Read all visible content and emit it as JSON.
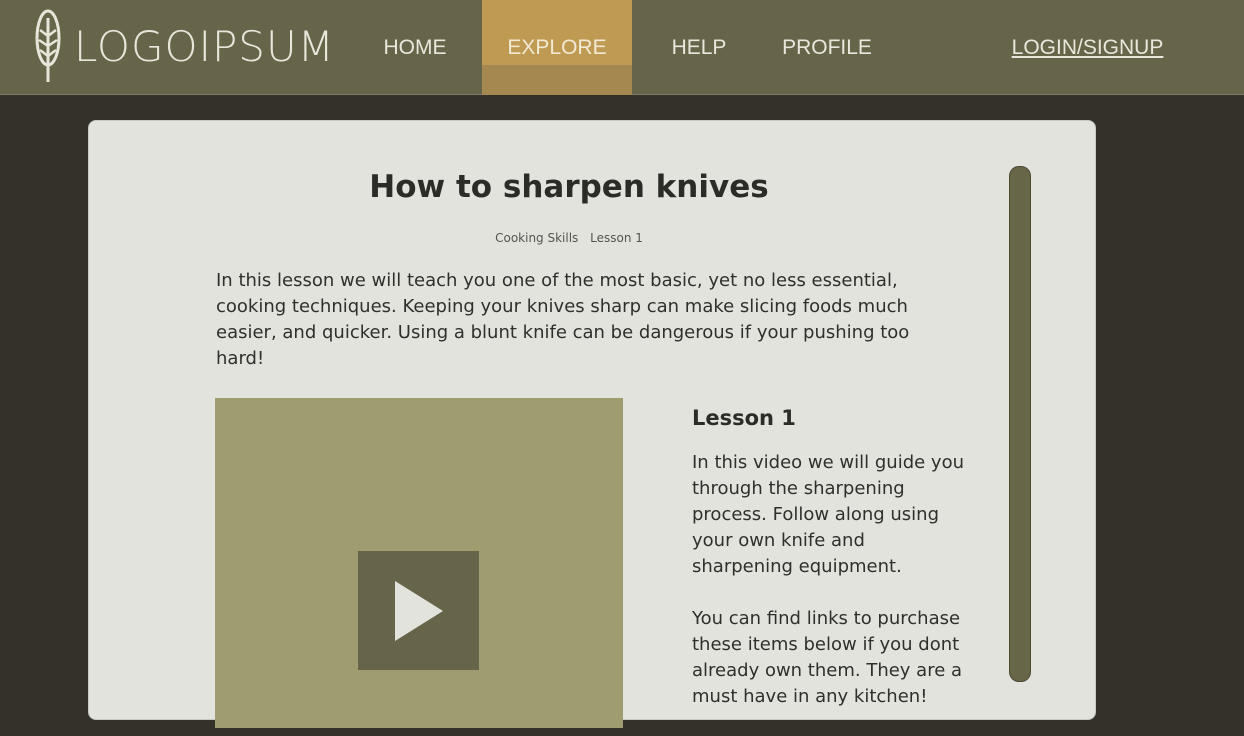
{
  "brand": {
    "logo_text": "LOGOIPSUM"
  },
  "nav": {
    "home": "HOME",
    "explore": "EXPLORE",
    "help": "HELP",
    "profile": "PROFILE",
    "login": "LOGIN/SIGNUP",
    "active": "EXPLORE"
  },
  "lesson_page": {
    "title": "How to sharpen knives",
    "category": "Cooking Skills",
    "lesson_tag": "Lesson 1",
    "intro": "In this lesson we will teach you one of the most basic, yet no less essential, cooking techniques. Keeping your knives sharp can make slicing foods much easier, and quicker. Using a blunt knife can be dangerous if your pushing too hard!",
    "section_heading": "Lesson 1",
    "paragraph_1": "In this video we will guide you through the sharpening process. Follow along using your own knife and sharpening equipment.",
    "paragraph_2": "You can find links to purchase these items below if you dont already own them. They are a must have in any kitchen!"
  },
  "colors": {
    "page_bg": "#33312a",
    "nav_bg": "#676549",
    "nav_active": "#bf9a52",
    "card_bg": "#e3e3de",
    "video_bg": "#9f9c70",
    "play_bg": "#676549",
    "scrollbar": "#686649"
  }
}
